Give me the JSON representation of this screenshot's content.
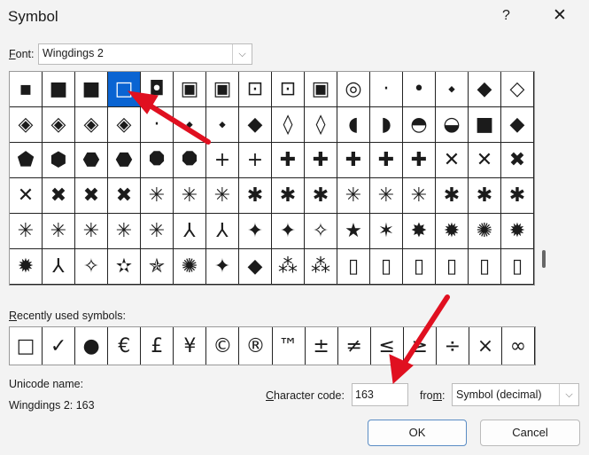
{
  "title": "Symbol",
  "help": "?",
  "close": "✕",
  "font": {
    "label_u": "F",
    "label_rest": "ont:",
    "value": "Wingdings 2"
  },
  "symbols": [
    [
      "▪",
      "■",
      "■",
      "□",
      "◘",
      "▣",
      "▣",
      "⊡",
      "⊡",
      "▣",
      "◎",
      "·",
      "•",
      "⬩",
      "◆",
      "◇"
    ],
    [
      "◈",
      "◈",
      "◈",
      "◈",
      "·",
      "⬩",
      "⬩",
      "◆",
      "◊",
      "◊",
      "◖",
      "◗",
      "◓",
      "◒",
      "■",
      "◆"
    ],
    [
      "⬟",
      "⬢",
      "⬣",
      "⬣",
      "⯃",
      "⯃",
      "+",
      "+",
      "✚",
      "✚",
      "✚",
      "✚",
      "✚",
      "✕",
      "✕",
      "✖"
    ],
    [
      "✕",
      "✖",
      "✖",
      "✖",
      "✳",
      "✳",
      "✳",
      "✱",
      "✱",
      "✱",
      "✳",
      "✳",
      "✳",
      "✱",
      "✱",
      "✱"
    ],
    [
      "✳",
      "✳",
      "✳",
      "✳",
      "✳",
      "⅄",
      "⅄",
      "✦",
      "✦",
      "✧",
      "★",
      "✶",
      "✸",
      "✹",
      "✺",
      "✹"
    ],
    [
      "✹",
      "⅄",
      "✧",
      "✫",
      "✯",
      "✺",
      "✦",
      "◆",
      "⁂",
      "⁂",
      "▯",
      "▯",
      "▯",
      "▯",
      "▯",
      "▯"
    ]
  ],
  "selected_index": 3,
  "recent": {
    "label_u": "R",
    "label_rest": "ecently used symbols:",
    "items": [
      "□",
      "✓",
      "●",
      "€",
      "£",
      "¥",
      "©",
      "®",
      "™",
      "±",
      "≠",
      "≤",
      "≥",
      "÷",
      "×",
      "∞"
    ]
  },
  "unicode_name_label": "Unicode name:",
  "unicode_name_value": "Wingdings 2: 163",
  "char_code": {
    "label_u": "C",
    "label_rest": "haracter code:",
    "value": "163"
  },
  "from": {
    "label_pre": "fro",
    "label_u": "m",
    "label_post": ":",
    "value": "Symbol (decimal)"
  },
  "ok": "OK",
  "cancel": "Cancel",
  "arrow_color": "#e01020"
}
